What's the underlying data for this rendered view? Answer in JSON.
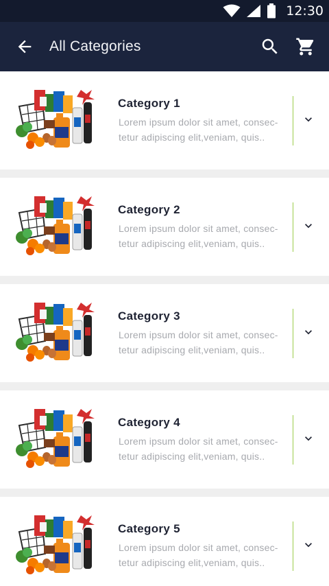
{
  "status_bar": {
    "time": "12:30",
    "icons": [
      "wifi-icon",
      "signal-icon",
      "battery-icon"
    ]
  },
  "app_bar": {
    "title": "All Categories",
    "back_icon": "arrow-back-icon",
    "search_icon": "search-icon",
    "cart_icon": "cart-icon"
  },
  "colors": {
    "status_bar": "#131a2d",
    "app_bar": "#1b243d",
    "divider_accent": "#9bcc4a",
    "background": "#efefef",
    "title_text": "#1f2333",
    "desc_text": "#a7a9ae"
  },
  "categories": [
    {
      "title": "Category 1",
      "desc_line1": "Lorem ipsum dolor sit amet, consec-",
      "desc_line2": "tetur adipiscing elit,veniam, quis.."
    },
    {
      "title": "Category 2",
      "desc_line1": "Lorem ipsum dolor sit amet, consec-",
      "desc_line2": "tetur adipiscing elit,veniam, quis.."
    },
    {
      "title": "Category 3",
      "desc_line1": "Lorem ipsum dolor sit amet, consec-",
      "desc_line2": "tetur adipiscing elit,veniam, quis.."
    },
    {
      "title": "Category 4",
      "desc_line1": "Lorem ipsum dolor sit amet, consec-",
      "desc_line2": "tetur adipiscing elit,veniam, quis.."
    },
    {
      "title": "Category 5",
      "desc_line1": "Lorem ipsum dolor sit amet, consec-",
      "desc_line2": "tetur adipiscing elit,veniam, quis.."
    }
  ]
}
